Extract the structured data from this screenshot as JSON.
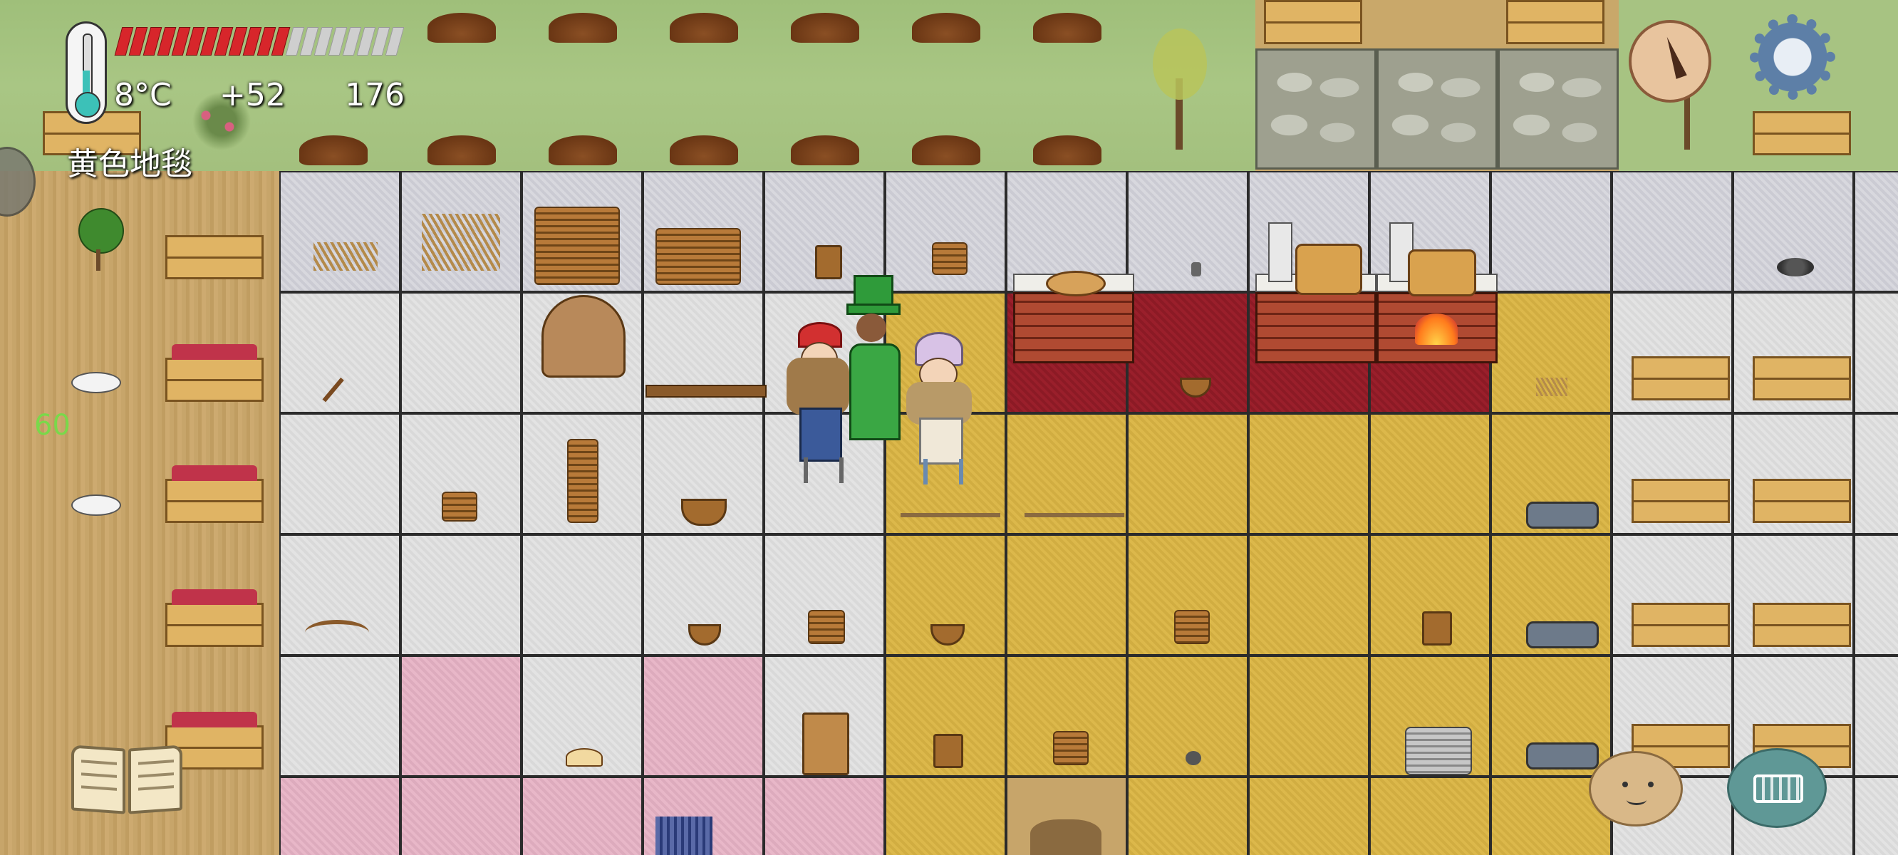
{
  "hud": {
    "temperature": "8°C",
    "yum_bonus": "+52",
    "yum_count": "176",
    "hover_label": "黄色地毯",
    "age_label": "60",
    "food_bar": {
      "filled": 12,
      "total": 20
    }
  },
  "icons": {
    "thermometer": "thermometer-icon",
    "compass": "compass-icon",
    "settings": "gear-icon",
    "tech_book": "book-icon",
    "emote": "potato-face-icon",
    "chat": "keyboard-icon"
  },
  "colors": {
    "food_on": "#d7262b",
    "food_off": "#cfcfcf",
    "thermometer": "#3cc1b8",
    "age_text": "#79d94a",
    "hud_text": "#ffffff"
  }
}
